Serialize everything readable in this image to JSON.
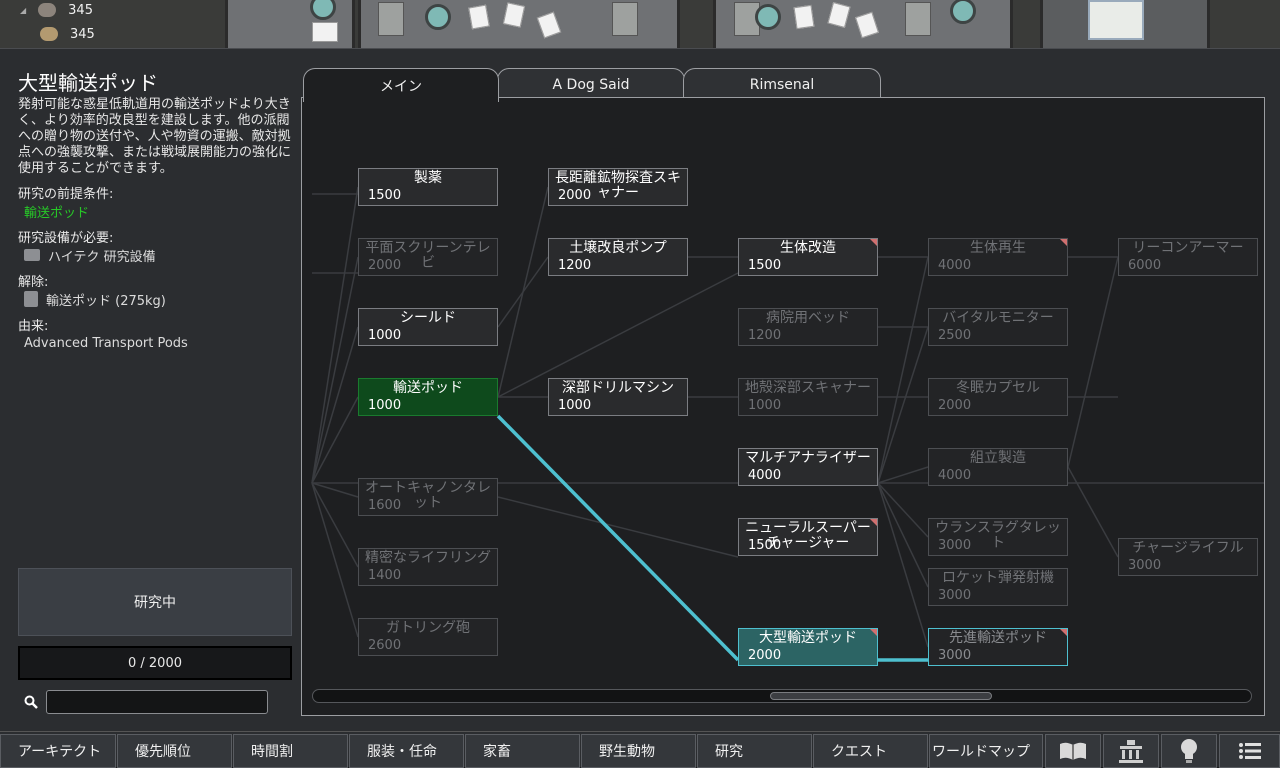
{
  "resources": [
    {
      "name": "steel-chunks-icon",
      "count": "345"
    },
    {
      "name": "sandstone-icon",
      "count": "345"
    }
  ],
  "project": {
    "title": "大型輸送ポッド",
    "description": "発射可能な惑星低軌道用の輸送ポッドより大きく、より効率的改良型を建設します。他の派閥への贈り物の送付や、人や物資の運搬、敵対拠点への強襲攻撃、または戦域展開能力の強化に使用することができます。",
    "prereq_label": "研究の前提条件:",
    "prereq_value": "輸送ポッド",
    "bench_label": "研究設備が必要:",
    "bench_value": "ハイテク 研究設備",
    "unlock_label": "解除:",
    "unlock_value": "輸送ポッド (275kg)",
    "source_label": "由来:",
    "source_value": "Advanced Transport Pods",
    "button_label": "研究中",
    "progress_text": "0 / 2000",
    "search_placeholder": ""
  },
  "tabs": [
    "メイン",
    "A Dog Said",
    "Rimsenal"
  ],
  "colors": {
    "accent": "#4ec0d0",
    "done": "#0e4a1c",
    "prereq_text": "#27c927"
  },
  "nodes": [
    {
      "label": "製薬",
      "cost": "1500",
      "state": "avail"
    },
    {
      "label": "平面スクリーンテレビ",
      "cost": "2000",
      "state": "locked"
    },
    {
      "label": "シールド",
      "cost": "1000",
      "state": "avail"
    },
    {
      "label": "輸送ポッド",
      "cost": "1000",
      "state": "done"
    },
    {
      "label": "オートキャノンタレット",
      "cost": "1600",
      "state": "locked"
    },
    {
      "label": "精密なライフリング",
      "cost": "1400",
      "state": "locked"
    },
    {
      "label": "ガトリング砲",
      "cost": "2600",
      "state": "locked"
    },
    {
      "label": "長距離鉱物探査スキャナー",
      "cost": "2000",
      "state": "avail"
    },
    {
      "label": "土壌改良ポンプ",
      "cost": "1200",
      "state": "avail"
    },
    {
      "label": "深部ドリルマシン",
      "cost": "1000",
      "state": "avail"
    },
    {
      "label": "生体改造",
      "cost": "1500",
      "state": "avail"
    },
    {
      "label": "病院用ベッド",
      "cost": "1200",
      "state": "locked"
    },
    {
      "label": "地殻深部スキャナー",
      "cost": "1000",
      "state": "locked"
    },
    {
      "label": "マルチアナライザー",
      "cost": "4000",
      "state": "avail"
    },
    {
      "label": "ニューラルスーパーチャージャー",
      "cost": "1500",
      "state": "avail"
    },
    {
      "label": "大型輸送ポッド",
      "cost": "2000",
      "state": "sel"
    },
    {
      "label": "生体再生",
      "cost": "4000",
      "state": "locked"
    },
    {
      "label": "バイタルモニター",
      "cost": "2500",
      "state": "locked"
    },
    {
      "label": "冬眠カプセル",
      "cost": "2000",
      "state": "locked"
    },
    {
      "label": "組立製造",
      "cost": "4000",
      "state": "locked"
    },
    {
      "label": "ウランスラグタレット",
      "cost": "3000",
      "state": "locked"
    },
    {
      "label": "ロケット弾発射機",
      "cost": "3000",
      "state": "locked"
    },
    {
      "label": "先進輸送ポッド",
      "cost": "3000",
      "state": "target"
    },
    {
      "label": "リーコンアーマー",
      "cost": "6000",
      "state": "locked"
    },
    {
      "label": "チャージライフル",
      "cost": "3000",
      "state": "locked"
    }
  ],
  "menu": [
    "アーキテクト",
    "優先順位",
    "時間割",
    "服装・任命",
    "家畜",
    "野生動物",
    "研究",
    "クエスト",
    "ワールドマップ"
  ],
  "menu_icons": [
    "book-icon",
    "factions-icon",
    "lightbulb-icon",
    "menu-icon"
  ]
}
